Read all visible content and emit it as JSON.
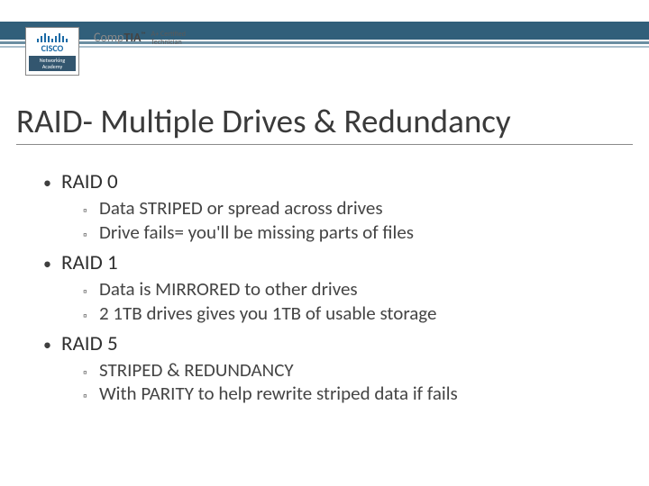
{
  "header": {
    "logos": {
      "cisco": {
        "brand": "CISCO",
        "sub": "Networking Academy"
      },
      "comptia": {
        "brand_prefix": "Comp",
        "brand_suffix": "TIA",
        "tm": "™",
        "sub_line1": "A+ Certified",
        "sub_line2": "Technician"
      }
    }
  },
  "title": "RAID- Multiple Drives & Redundancy",
  "body": {
    "items": [
      {
        "label": "RAID 0",
        "sub": [
          "Data STRIPED or spread across drives",
          "Drive fails= you'll be missing parts of files"
        ]
      },
      {
        "label": "RAID 1",
        "sub": [
          "Data is MIRRORED to other drives",
          "2 1TB drives gives you 1TB of usable storage"
        ]
      },
      {
        "label": "RAID 5",
        "sub": [
          "STRIPED & REDUNDANCY",
          "With PARITY to help rewrite striped data if fails"
        ]
      }
    ]
  }
}
